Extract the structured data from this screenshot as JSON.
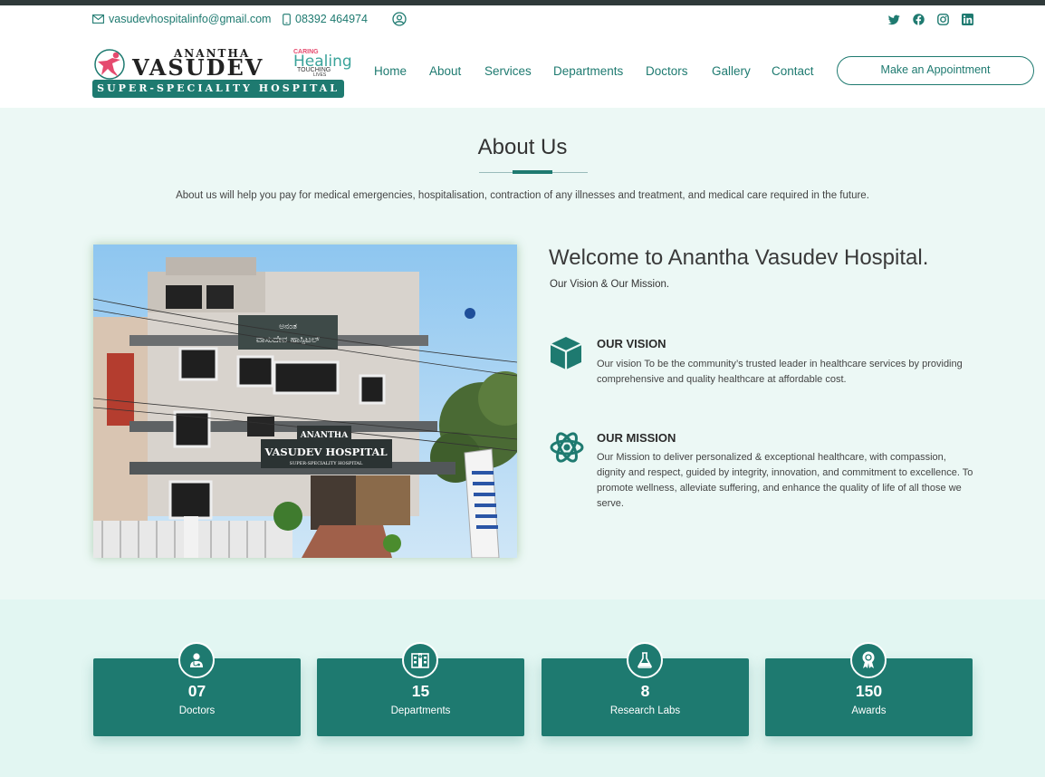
{
  "topbar": {
    "email": "vasudevhospitalinfo@gmail.com",
    "phone": "08392 464974"
  },
  "logo": {
    "line1": "ANANTHA",
    "line2": "VASUDEV",
    "band": "SUPER-SPECIALITY HOSPITAL",
    "tag_caring": "CARING",
    "tag_healing": "Healing",
    "tag_touching": "TOUCHING",
    "tag_lives": "LIVES"
  },
  "nav": {
    "items": [
      "Home",
      "About",
      "Services",
      "Departments",
      "Doctors",
      "Gallery",
      "Contact"
    ],
    "cta": "Make an Appointment"
  },
  "about": {
    "title": "About Us",
    "subtitle": "About us will help you pay for medical emergencies, hospitalisation, contraction of any illnesses and treatment, and medical care required in the future.",
    "welcome": "Welcome to Anantha Vasudev Hospital.",
    "welcome_sub": "Our Vision & Our Mission.",
    "vision_title": "OUR VISION",
    "vision_text": "Our vision To be the community’s trusted leader in healthcare services by providing comprehensive and quality healthcare at affordable cost.",
    "mission_title": "OUR MISSION",
    "mission_text": "Our Mission to deliver personalized & exceptional healthcare, with compassion, dignity and respect, guided by integrity, innovation, and commitment to excellence. To promote wellness, alleviate suffering, and enhance the quality of life of all those we serve."
  },
  "photo_signs": {
    "kannada_top": "ಅನಂತ",
    "kannada_name": "ವಾಸುದೇವ ಹಾಸ್ಪಿಟಲ್",
    "sign_anantha": "ANANTHA",
    "sign_name": "VASUDEV HOSPITAL",
    "sign_sub": "SUPER-SPECIALITY HOSPITAL"
  },
  "stats": [
    {
      "value": "07",
      "label": "Doctors",
      "icon": "doctor-icon"
    },
    {
      "value": "15",
      "label": "Departments",
      "icon": "hospital-building-icon"
    },
    {
      "value": "8",
      "label": "Research Labs",
      "icon": "flask-icon"
    },
    {
      "value": "150",
      "label": "Awards",
      "icon": "award-icon"
    }
  ],
  "colors": {
    "accent": "#1e7a70",
    "section_bg": "#ecf8f5",
    "stats_bg": "#e2f6f2"
  }
}
